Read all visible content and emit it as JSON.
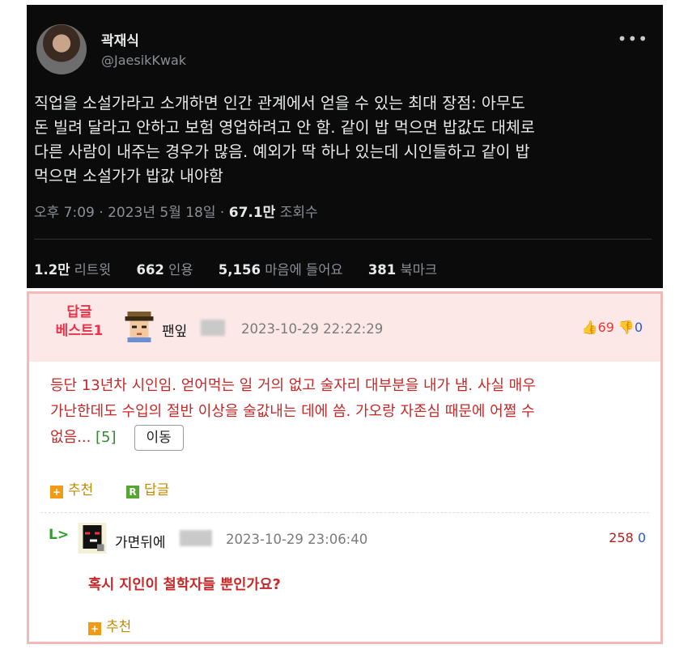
{
  "tweet": {
    "author_name": "곽재식",
    "handle": "@JaesikKwak",
    "more_icon": "•••",
    "body_lines": [
      "직업을 소설가라고 소개하면 인간 관계에서 얻을 수 있는 최대 장점: 아무도",
      "돈 빌려 달라고 안하고 보험 영업하려고 안 함. 같이 밥 먹으면 밥값도 대체로",
      "다른 사람이 내주는 경우가 많음. 예외가 딱 하나 있는데 시인들하고 같이 밥",
      "먹으면 소설가가 밥값 내야함"
    ],
    "time": "오후 7:09 · 2023년 5월 18일 · ",
    "views_count": "67.1만",
    "views_label": " 조회수",
    "stats": {
      "retweets": {
        "count": "1.2만",
        "label": " 리트윗"
      },
      "quotes": {
        "count": "662",
        "label": " 인용"
      },
      "likes": {
        "count": "5,156",
        "label": " 마음에 들어요"
      },
      "bookmarks": {
        "count": "381",
        "label": " 북마크"
      }
    }
  },
  "best_comment": {
    "badge_line1": "답글",
    "badge_line2": "베스트1",
    "author": "팬잎",
    "date": "2023-10-29 22:22:29",
    "upvote_icon": "👍",
    "upvotes": "69",
    "downvote_icon": "👎",
    "downvotes": "0",
    "text_lines": [
      "등단 13년차 시인임. 얻어먹는 일 거의 없고 술자리 대부분을 내가 냄. 사실 매우",
      "가난한데도 수입의 절반 이상을 술값내는 데에 씀. 가오랑 자존심 때문에 어쩔 수"
    ],
    "text_last": "없음...",
    "more_count": "[5]",
    "move_label": "이동",
    "recommend_label": "추천",
    "reply_label": "답글"
  },
  "reply_comment": {
    "reply_arrow": "L>",
    "author": "가면뒤에",
    "date": "2023-10-29 23:06:40",
    "upvotes": "258",
    "downvotes": "0",
    "text": "혹시 지인이 철학자들 뿐인가요?",
    "recommend_label": "추천"
  },
  "colors": {
    "tweet_bg": "#0b0b0b",
    "best_header_bg": "#fde8e8",
    "comment_text": "#c62828",
    "border": "#f3b8b8"
  }
}
